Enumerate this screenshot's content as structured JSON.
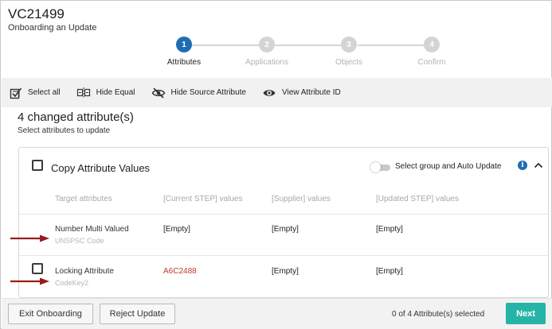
{
  "header": {
    "title": "VC21499",
    "subtitle": "Onboarding an Update"
  },
  "stepper": {
    "steps": [
      {
        "number": "1",
        "label": "Attributes",
        "active": true
      },
      {
        "number": "2",
        "label": "Applications",
        "active": false
      },
      {
        "number": "3",
        "label": "Objects",
        "active": false
      },
      {
        "number": "4",
        "label": "Confirm",
        "active": false
      }
    ]
  },
  "toolbar": {
    "select_all": "Select all",
    "hide_equal": "Hide Equal",
    "hide_source": "Hide Source Attribute",
    "view_id": "View Attribute ID",
    "icons": [
      "select-all-icon",
      "hide-equal-icon",
      "eye-slash-icon",
      "eye-icon"
    ]
  },
  "main": {
    "heading": "4 changed attribute(s)",
    "subheading": "Select attributes to update"
  },
  "panel": {
    "title": "Copy Attribute Values",
    "group_toggle_label": "Select group and Auto Update",
    "info_symbol": "i",
    "columns": [
      "Target attributes",
      "[Current STEP] values",
      "[Supplier] values",
      "[Updated STEP] values"
    ],
    "rows": [
      {
        "name": "Number Multi Valued",
        "id": "UNSPSC Code",
        "current": "[Empty]",
        "supplier": "[Empty]",
        "updated": "[Empty]",
        "has_checkbox": false
      },
      {
        "name": "Locking Attribute",
        "id": "CodeKey2",
        "current": "A6C2488",
        "supplier": "[Empty]",
        "updated": "[Empty]",
        "has_checkbox": true
      }
    ]
  },
  "footer": {
    "exit": "Exit Onboarding",
    "reject": "Reject Update",
    "count": "0 of 4 Attribute(s) selected",
    "next": "Next"
  },
  "colors": {
    "accent": "#1f6cb5",
    "next_button": "#27b4a8",
    "locked_value": "#c0392b",
    "annotation_arrow": "#9b1b1b"
  }
}
